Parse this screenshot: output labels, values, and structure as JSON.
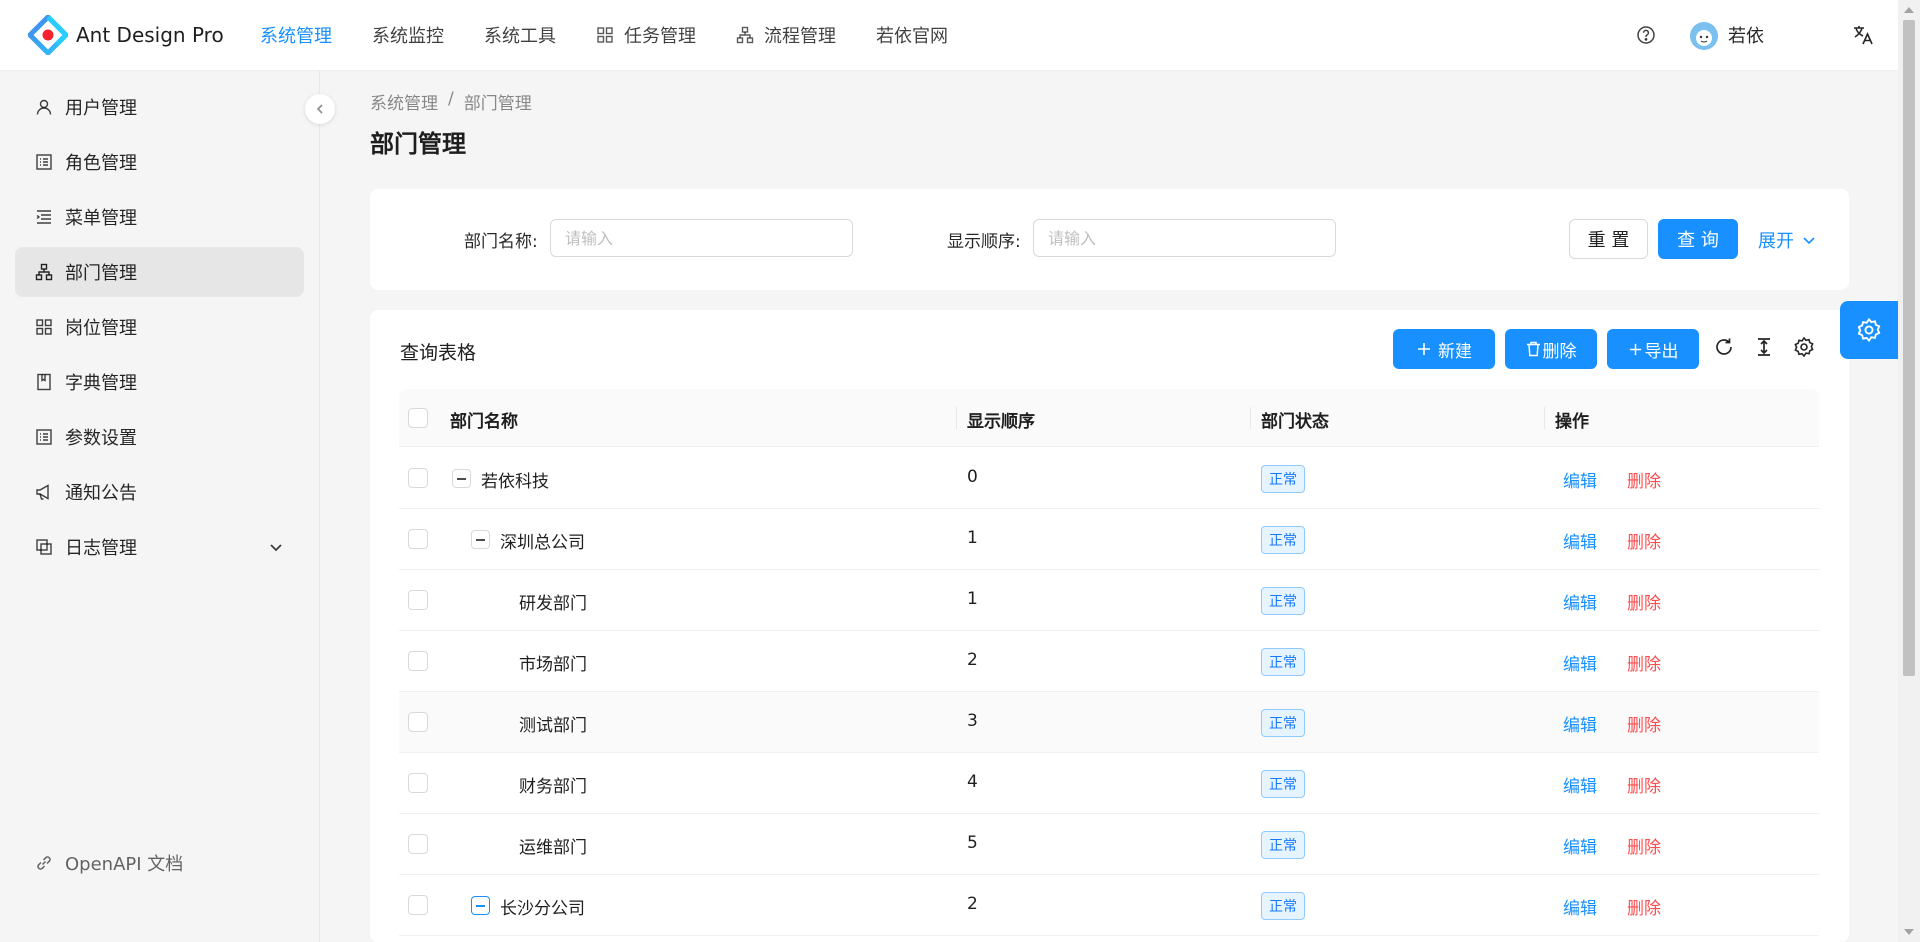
{
  "app": {
    "title": "Ant Design Pro",
    "username": "若依",
    "accent": "#1890ff"
  },
  "topnav": [
    {
      "label": "系统管理",
      "icon": null,
      "active": true
    },
    {
      "label": "系统监控",
      "icon": null,
      "active": false
    },
    {
      "label": "系统工具",
      "icon": null,
      "active": false
    },
    {
      "label": "任务管理",
      "icon": "grid-icon",
      "active": false
    },
    {
      "label": "流程管理",
      "icon": "cluster-icon",
      "active": false
    },
    {
      "label": "若依官网",
      "icon": null,
      "active": false
    }
  ],
  "sidebar": {
    "items": [
      {
        "label": "用户管理",
        "icon": "user-icon"
      },
      {
        "label": "角色管理",
        "icon": "profile-icon"
      },
      {
        "label": "菜单管理",
        "icon": "menu-icon"
      },
      {
        "label": "部门管理",
        "icon": "cluster-icon",
        "active": true
      },
      {
        "label": "岗位管理",
        "icon": "appstore-icon"
      },
      {
        "label": "字典管理",
        "icon": "book-icon"
      },
      {
        "label": "参数设置",
        "icon": "profile-icon"
      },
      {
        "label": "通知公告",
        "icon": "notification-icon"
      },
      {
        "label": "日志管理",
        "icon": "copy-icon",
        "expandable": true
      }
    ],
    "footer_label": "OpenAPI 文档"
  },
  "breadcrumb": {
    "parent": "系统管理",
    "separator": "/",
    "current": "部门管理"
  },
  "page_title": "部门管理",
  "search": {
    "dept_name_label": "部门名称:",
    "dept_name_placeholder": "请输入",
    "order_label": "显示顺序:",
    "order_placeholder": "请输入",
    "reset_label": "重 置",
    "query_label": "查 询",
    "expand_label": "展开"
  },
  "table": {
    "title": "查询表格",
    "new_label": "新建",
    "delete_label": "删除",
    "export_label": "导出",
    "columns": [
      "部门名称",
      "显示顺序",
      "部门状态",
      "操作"
    ],
    "edit_label": "编辑",
    "del_label": "删除",
    "rows": [
      {
        "name": "若依科技",
        "order": "0",
        "status": "正常",
        "level": 0,
        "toggle": true
      },
      {
        "name": "深圳总公司",
        "order": "1",
        "status": "正常",
        "level": 1,
        "toggle": true
      },
      {
        "name": "研发部门",
        "order": "1",
        "status": "正常",
        "level": 2,
        "toggle": false
      },
      {
        "name": "市场部门",
        "order": "2",
        "status": "正常",
        "level": 2,
        "toggle": false
      },
      {
        "name": "测试部门",
        "order": "3",
        "status": "正常",
        "level": 2,
        "toggle": false
      },
      {
        "name": "财务部门",
        "order": "4",
        "status": "正常",
        "level": 2,
        "toggle": false
      },
      {
        "name": "运维部门",
        "order": "5",
        "status": "正常",
        "level": 2,
        "toggle": false
      },
      {
        "name": "长沙分公司",
        "order": "2",
        "status": "正常",
        "level": 1,
        "toggle": true
      }
    ]
  }
}
